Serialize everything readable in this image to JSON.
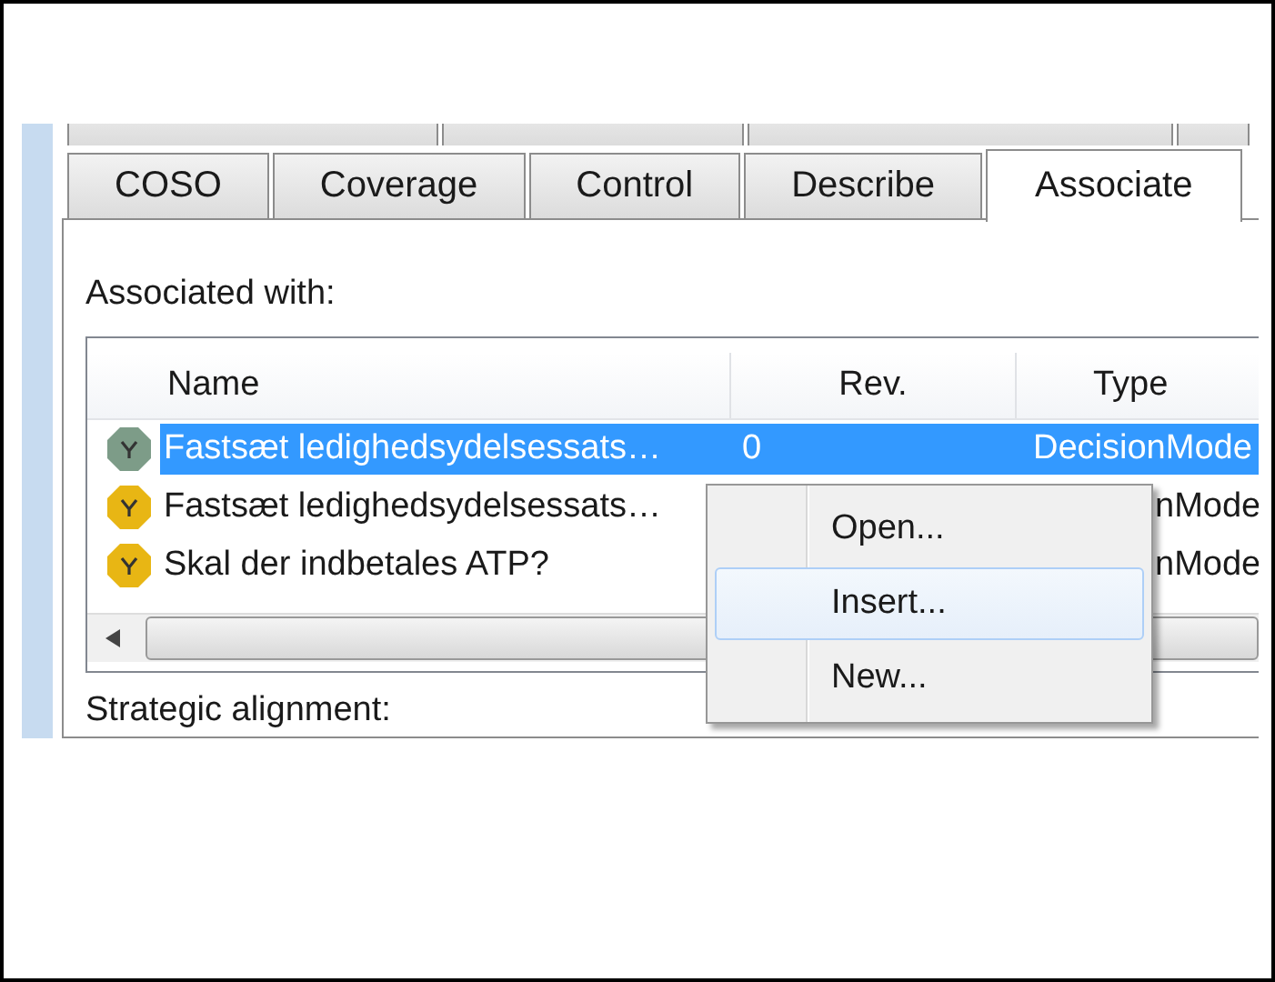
{
  "tab_rows": [
    [
      {
        "label": "COSO",
        "selected": false
      },
      {
        "label": "Coverage",
        "selected": false
      },
      {
        "label": "Control",
        "selected": false
      },
      {
        "label": "Describe",
        "selected": false
      },
      {
        "label": "Associate",
        "selected": true
      }
    ]
  ],
  "associated_label": "Associated with:",
  "table": {
    "columns": [
      "Name",
      "Rev.",
      "Type"
    ],
    "rows": [
      {
        "name": "Fastsæt ledighedsydelsessats…",
        "rev": "0",
        "type": "DecisionMode",
        "color": "#7d9c88",
        "selected": true
      },
      {
        "name": "Fastsæt ledighedsydelsessats…",
        "type": "nMode",
        "color": "#e8b614",
        "selected": false
      },
      {
        "name": "Skal der indbetales ATP?",
        "type": "nMode",
        "color": "#e8b614",
        "selected": false
      }
    ]
  },
  "context_menu": [
    {
      "label": "Open...",
      "highlighted": false
    },
    {
      "label": "Insert...",
      "highlighted": true
    },
    {
      "label": "New...",
      "highlighted": false
    }
  ],
  "strategic_label": "Strategic alignment:"
}
